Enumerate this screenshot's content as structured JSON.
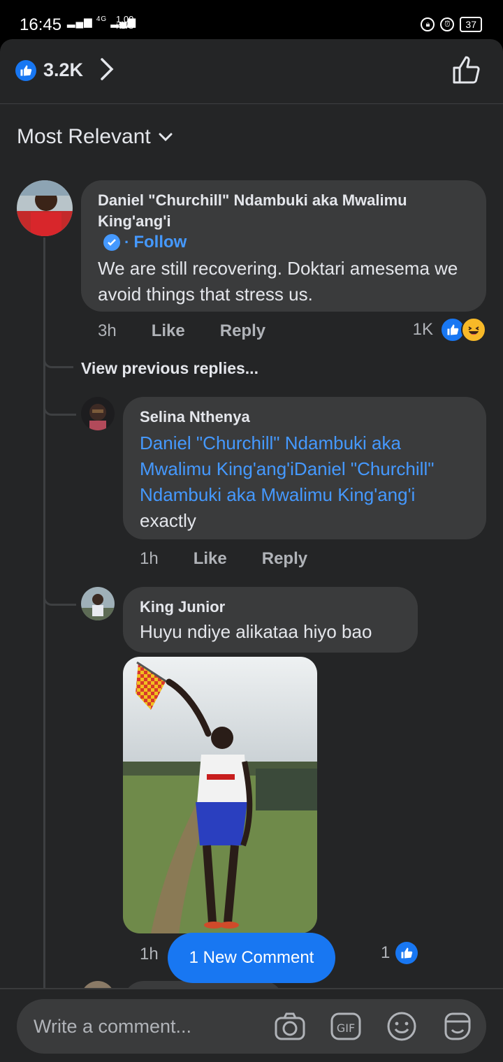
{
  "status_bar": {
    "time": "16:45",
    "network": "4G",
    "speed_value": "1.00",
    "speed_unit": "KB/S",
    "battery": "37"
  },
  "reactions_header": {
    "count": "3.2K",
    "icons": [
      "like-icon",
      "chevron-right-icon",
      "thumbs-up-outline-icon"
    ]
  },
  "filter": {
    "label": "Most Relevant"
  },
  "comments": [
    {
      "author": "Daniel \"Churchill\" Ndambuki aka Mwalimu King'ang'i",
      "verified": true,
      "follow_label": "Follow",
      "text": "We are still recovering. Doktari amesema we avoid things that stress us.",
      "time": "3h",
      "like_label": "Like",
      "reply_label": "Reply",
      "reaction_count": "1K"
    }
  ],
  "view_previous": "View previous replies...",
  "replies": [
    {
      "author": "Selina Nthenya",
      "mention": "Daniel \"Churchill\" Ndambuki aka Mwalimu King'ang'iDaniel \"Churchill\" Ndambuki aka Mwalimu King'ang'i",
      "text": "exactly",
      "time": "1h",
      "like_label": "Like",
      "reply_label": "Reply"
    },
    {
      "author": "King Junior",
      "text": "Huyu ndiye alikataa hiyo bao",
      "time": "1h",
      "reaction_count": "1"
    }
  ],
  "new_comment_label": "1 New Comment",
  "composer": {
    "placeholder": "Write a comment...",
    "icons": [
      "camera-icon",
      "gif-icon",
      "emoji-icon",
      "sticker-icon"
    ]
  },
  "colors": {
    "accent": "#1877f2",
    "bubble": "#3a3b3c",
    "sheet": "#242526",
    "mention": "#4599ff"
  }
}
